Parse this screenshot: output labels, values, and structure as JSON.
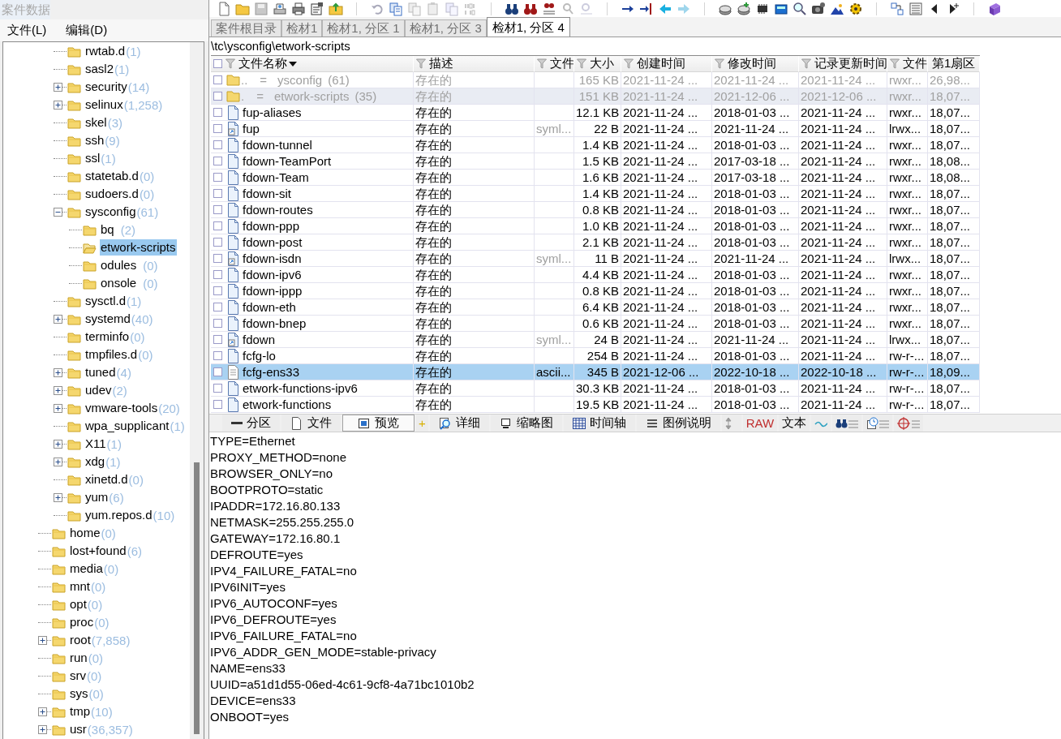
{
  "app_title": "案件数据",
  "menu": [
    "文件(L)",
    "编辑(D)"
  ],
  "tree": {
    "items": [
      {
        "children": [
          {
            "name": "rwtab.d",
            "count": "(1)",
            "selected": false
          },
          {
            "name": "sasl2",
            "count": "(1)",
            "selected": false
          },
          {
            "name": "security",
            "count": "(14)",
            "expanded": false,
            "selected": false
          },
          {
            "name": "selinux",
            "count": "(1,258)",
            "expanded": false,
            "selected": false
          },
          {
            "name": "skel",
            "count": "(3)",
            "selected": false
          },
          {
            "name": "ssh",
            "count": "(9)",
            "selected": false
          },
          {
            "name": "ssl",
            "count": "(1)",
            "selected": false
          },
          {
            "name": "statetab.d",
            "count": "(0)",
            "selected": false
          },
          {
            "name": "sudoers.d",
            "count": "(0)",
            "selected": false
          },
          {
            "name": "sysconfig",
            "count": "(61)",
            "expanded": true,
            "selected": false,
            "children": [
              {
                "name": "bq",
                "count": "(2)",
                "selected": false
              },
              {
                "name": "etwork-scripts",
                "selected": true
              },
              {
                "name": "odules",
                "count": "(0)",
                "selected": false
              },
              {
                "name": "onsole",
                "count": "(0)",
                "selected": false
              }
            ]
          },
          {
            "name": "sysctl.d",
            "count": "(1)",
            "selected": false
          },
          {
            "name": "systemd",
            "count": "(40)",
            "expanded": false,
            "selected": false
          },
          {
            "name": "terminfo",
            "count": "(0)",
            "selected": false
          },
          {
            "name": "tmpfiles.d",
            "count": "(0)",
            "selected": false
          },
          {
            "name": "tuned",
            "count": "(4)",
            "expanded": false,
            "selected": false
          },
          {
            "name": "udev",
            "count": "(2)",
            "expanded": false,
            "selected": false
          },
          {
            "name": "vmware-tools",
            "count": "(20)",
            "expanded": false,
            "selected": false
          },
          {
            "name": "wpa_supplicant",
            "count": "(1)",
            "selected": false
          },
          {
            "name": "X11",
            "count": "(1)",
            "expanded": false,
            "selected": false
          },
          {
            "name": "xdg",
            "count": "(1)",
            "expanded": false,
            "selected": false
          },
          {
            "name": "xinetd.d",
            "count": "(0)",
            "selected": false
          },
          {
            "name": "yum",
            "count": "(6)",
            "expanded": false,
            "selected": false
          },
          {
            "name": "yum.repos.d",
            "count": "(10)",
            "selected": false
          }
        ]
      },
      {
        "name": "home",
        "count": "(0)",
        "selected": false
      },
      {
        "name": "lost+found",
        "count": "(6)",
        "selected": false
      },
      {
        "name": "media",
        "count": "(0)",
        "selected": false
      },
      {
        "name": "mnt",
        "count": "(0)",
        "selected": false
      },
      {
        "name": "opt",
        "count": "(0)",
        "selected": false
      },
      {
        "name": "proc",
        "count": "(0)",
        "selected": false
      },
      {
        "name": "root",
        "count": "(7,858)",
        "expanded": false,
        "selected": false
      },
      {
        "name": "run",
        "count": "(0)",
        "selected": false
      },
      {
        "name": "srv",
        "count": "(0)",
        "selected": false
      },
      {
        "name": "sys",
        "count": "(0)",
        "selected": false
      },
      {
        "name": "tmp",
        "count": "(10)",
        "expanded": false,
        "selected": false
      },
      {
        "name": "usr",
        "count": "(36,357)",
        "expanded": false,
        "selected": false
      }
    ]
  },
  "tabs": [
    {
      "label": "案件根目录",
      "selected": false
    },
    {
      "label": "检材1",
      "selected": false
    },
    {
      "label": "检材1, 分区 1",
      "selected": false
    },
    {
      "label": "检材1, 分区 3",
      "selected": false
    },
    {
      "label": "检材1, 分区 4",
      "selected": true
    }
  ],
  "path": "\\tc\\ysconfig\\etwork-scripts",
  "table": {
    "select_all_checked": false,
    "columns": [
      {
        "label": "文件名称",
        "filterable": true,
        "sorted": true
      },
      {
        "label": "描述",
        "filterable": true,
        "sorted": false
      },
      {
        "label": "文件",
        "filterable": true,
        "sorted": false
      },
      {
        "label": "大小",
        "filterable": true,
        "sorted": false
      },
      {
        "label": "创建时间",
        "filterable": true,
        "sorted": false
      },
      {
        "label": "修改时间",
        "filterable": true,
        "sorted": false
      },
      {
        "label": "记录更新时间",
        "filterable": true,
        "sorted": false
      },
      {
        "label": "文件",
        "filterable": true,
        "sorted": false
      },
      {
        "label": "第1扇区",
        "filterable": false,
        "sorted": false
      }
    ],
    "rows": [
      {
        "kind": "parent",
        "prefix": "..",
        "sep": "=",
        "name": "ysconfig",
        "count": "(61)",
        "checked": false,
        "selected": false,
        "desc": "存在的",
        "size": "165 KB",
        "created": "2021-11-24 ...",
        "modified": "2021-11-24 ...",
        "updated": "2021-11-24 ...",
        "attr": "rwxr...",
        "sector": "26,98..."
      },
      {
        "kind": "current",
        "prefix": ".",
        "sep": "=",
        "name": "etwork-scripts",
        "count": "(35)",
        "checked": false,
        "selected": false,
        "desc": "存在的",
        "size": "151 KB",
        "created": "2021-11-24 ...",
        "modified": "2021-12-06 ...",
        "updated": "2021-12-06 ...",
        "attr": "rwxr...",
        "sector": "18,07..."
      },
      {
        "kind": "file",
        "name": "fup-aliases",
        "checked": false,
        "selected": false,
        "desc": "存在的",
        "size": "12.1 KB",
        "created": "2021-11-24 ...",
        "modified": "2018-01-03 ...",
        "updated": "2021-11-24 ...",
        "attr": "rwxr...",
        "sector": "18,07..."
      },
      {
        "kind": "symlink",
        "name": "fup",
        "checked": false,
        "selected": false,
        "desc": "存在的",
        "type": "syml...",
        "size": "22 B",
        "created": "2021-11-24 ...",
        "modified": "2021-11-24 ...",
        "updated": "2021-11-24 ...",
        "attr": "lrwx...",
        "sector": "18,07..."
      },
      {
        "kind": "file",
        "name": "fdown-tunnel",
        "checked": false,
        "selected": false,
        "desc": "存在的",
        "size": "1.4 KB",
        "created": "2021-11-24 ...",
        "modified": "2018-01-03 ...",
        "updated": "2021-11-24 ...",
        "attr": "rwxr...",
        "sector": "18,07..."
      },
      {
        "kind": "file",
        "name": "fdown-TeamPort",
        "checked": false,
        "selected": false,
        "desc": "存在的",
        "size": "1.5 KB",
        "created": "2021-11-24 ...",
        "modified": "2017-03-18 ...",
        "updated": "2021-11-24 ...",
        "attr": "rwxr...",
        "sector": "18,08..."
      },
      {
        "kind": "file",
        "name": "fdown-Team",
        "checked": false,
        "selected": false,
        "desc": "存在的",
        "size": "1.6 KB",
        "created": "2021-11-24 ...",
        "modified": "2017-03-18 ...",
        "updated": "2021-11-24 ...",
        "attr": "rwxr...",
        "sector": "18,08..."
      },
      {
        "kind": "file",
        "name": "fdown-sit",
        "checked": false,
        "selected": false,
        "desc": "存在的",
        "size": "1.4 KB",
        "created": "2021-11-24 ...",
        "modified": "2018-01-03 ...",
        "updated": "2021-11-24 ...",
        "attr": "rwxr...",
        "sector": "18,07..."
      },
      {
        "kind": "file",
        "name": "fdown-routes",
        "checked": false,
        "selected": false,
        "desc": "存在的",
        "size": "0.8 KB",
        "created": "2021-11-24 ...",
        "modified": "2018-01-03 ...",
        "updated": "2021-11-24 ...",
        "attr": "rwxr...",
        "sector": "18,07..."
      },
      {
        "kind": "file",
        "name": "fdown-ppp",
        "checked": false,
        "selected": false,
        "desc": "存在的",
        "size": "1.0 KB",
        "created": "2021-11-24 ...",
        "modified": "2018-01-03 ...",
        "updated": "2021-11-24 ...",
        "attr": "rwxr...",
        "sector": "18,07..."
      },
      {
        "kind": "file",
        "name": "fdown-post",
        "checked": false,
        "selected": false,
        "desc": "存在的",
        "size": "2.1 KB",
        "created": "2021-11-24 ...",
        "modified": "2018-01-03 ...",
        "updated": "2021-11-24 ...",
        "attr": "rwxr...",
        "sector": "18,07..."
      },
      {
        "kind": "symlink",
        "name": "fdown-isdn",
        "checked": false,
        "selected": false,
        "desc": "存在的",
        "type": "syml...",
        "size": "11 B",
        "created": "2021-11-24 ...",
        "modified": "2021-11-24 ...",
        "updated": "2021-11-24 ...",
        "attr": "lrwx...",
        "sector": "18,07..."
      },
      {
        "kind": "file",
        "name": "fdown-ipv6",
        "checked": false,
        "selected": false,
        "desc": "存在的",
        "size": "4.4 KB",
        "created": "2021-11-24 ...",
        "modified": "2018-01-03 ...",
        "updated": "2021-11-24 ...",
        "attr": "rwxr...",
        "sector": "18,07..."
      },
      {
        "kind": "file",
        "name": "fdown-ippp",
        "checked": false,
        "selected": false,
        "desc": "存在的",
        "size": "0.8 KB",
        "created": "2021-11-24 ...",
        "modified": "2018-01-03 ...",
        "updated": "2021-11-24 ...",
        "attr": "rwxr...",
        "sector": "18,07..."
      },
      {
        "kind": "file",
        "name": "fdown-eth",
        "checked": false,
        "selected": false,
        "desc": "存在的",
        "size": "6.4 KB",
        "created": "2021-11-24 ...",
        "modified": "2018-01-03 ...",
        "updated": "2021-11-24 ...",
        "attr": "rwxr...",
        "sector": "18,07..."
      },
      {
        "kind": "file",
        "name": "fdown-bnep",
        "checked": false,
        "selected": false,
        "desc": "存在的",
        "size": "0.6 KB",
        "created": "2021-11-24 ...",
        "modified": "2018-01-03 ...",
        "updated": "2021-11-24 ...",
        "attr": "rwxr...",
        "sector": "18,07..."
      },
      {
        "kind": "symlink",
        "name": "fdown",
        "checked": false,
        "selected": false,
        "desc": "存在的",
        "type": "syml...",
        "size": "24 B",
        "created": "2021-11-24 ...",
        "modified": "2021-11-24 ...",
        "updated": "2021-11-24 ...",
        "attr": "lrwx...",
        "sector": "18,07..."
      },
      {
        "kind": "file",
        "name": "fcfg-lo",
        "checked": false,
        "selected": false,
        "desc": "存在的",
        "size": "254 B",
        "created": "2021-11-24 ...",
        "modified": "2018-01-03 ...",
        "updated": "2021-11-24 ...",
        "attr": "rw-r-...",
        "sector": "18,07..."
      },
      {
        "kind": "text",
        "name": "fcfg-ens33",
        "checked": false,
        "selected": true,
        "desc": "存在的",
        "type": "ascii...",
        "size": "345 B",
        "created": "2021-12-06 ...",
        "modified": "2022-10-18 ...",
        "updated": "2022-10-18 ...",
        "attr": "rw-r-...",
        "sector": "18,09..."
      },
      {
        "kind": "file",
        "name": "etwork-functions-ipv6",
        "checked": false,
        "selected": false,
        "desc": "存在的",
        "size": "30.3 KB",
        "created": "2021-11-24 ...",
        "modified": "2018-01-03 ...",
        "updated": "2021-11-24 ...",
        "attr": "rw-r-...",
        "sector": "18,07..."
      },
      {
        "kind": "file",
        "name": "etwork-functions",
        "checked": false,
        "selected": false,
        "desc": "存在的",
        "size": "19.5 KB",
        "created": "2021-11-24 ...",
        "modified": "2018-01-03 ...",
        "updated": "2021-11-24 ...",
        "attr": "rw-r-...",
        "sector": "18,07..."
      }
    ]
  },
  "view_tabs": [
    {
      "kind": "partition",
      "label": "分区",
      "selected": false
    },
    {
      "kind": "file",
      "label": "文件",
      "selected": false
    },
    {
      "kind": "preview",
      "label": "预览",
      "selected": true
    },
    {
      "kind": "add",
      "label": "+",
      "selected": false
    },
    {
      "kind": "details",
      "label": "详细",
      "selected": false
    },
    {
      "kind": "thumbnails",
      "label": "缩略图",
      "selected": false
    },
    {
      "kind": "timeline",
      "label": "时间轴",
      "selected": false
    },
    {
      "kind": "legend",
      "label": "图例说明",
      "selected": false
    },
    {
      "kind": "sort",
      "selected": false
    },
    {
      "kind": "raw",
      "label": "RAW",
      "selected": false
    },
    {
      "kind": "text",
      "label": "文本",
      "selected": false
    },
    {
      "kind": "wave",
      "selected": false
    },
    {
      "kind": "search_list",
      "selected": false
    },
    {
      "kind": "clock_list",
      "selected": false
    },
    {
      "kind": "target_list",
      "selected": false
    }
  ],
  "preview_lines": [
    "TYPE=Ethernet",
    "PROXY_METHOD=none",
    "BROWSER_ONLY=no",
    "BOOTPROTO=static",
    "IPADDR=172.16.80.133",
    "NETMASK=255.255.255.0",
    "GATEWAY=172.16.80.1",
    "DEFROUTE=yes",
    "IPV4_FAILURE_FATAL=no",
    "IPV6INIT=yes",
    "IPV6_AUTOCONF=yes",
    "IPV6_DEFROUTE=yes",
    "IPV6_FAILURE_FATAL=no",
    "IPV6_ADDR_GEN_MODE=stable-privacy",
    "NAME=ens33",
    "UUID=a51d1d55-06ed-4c61-9cf8-4a71bc1010b2",
    "DEVICE=ens33",
    "ONBOOT=yes"
  ]
}
